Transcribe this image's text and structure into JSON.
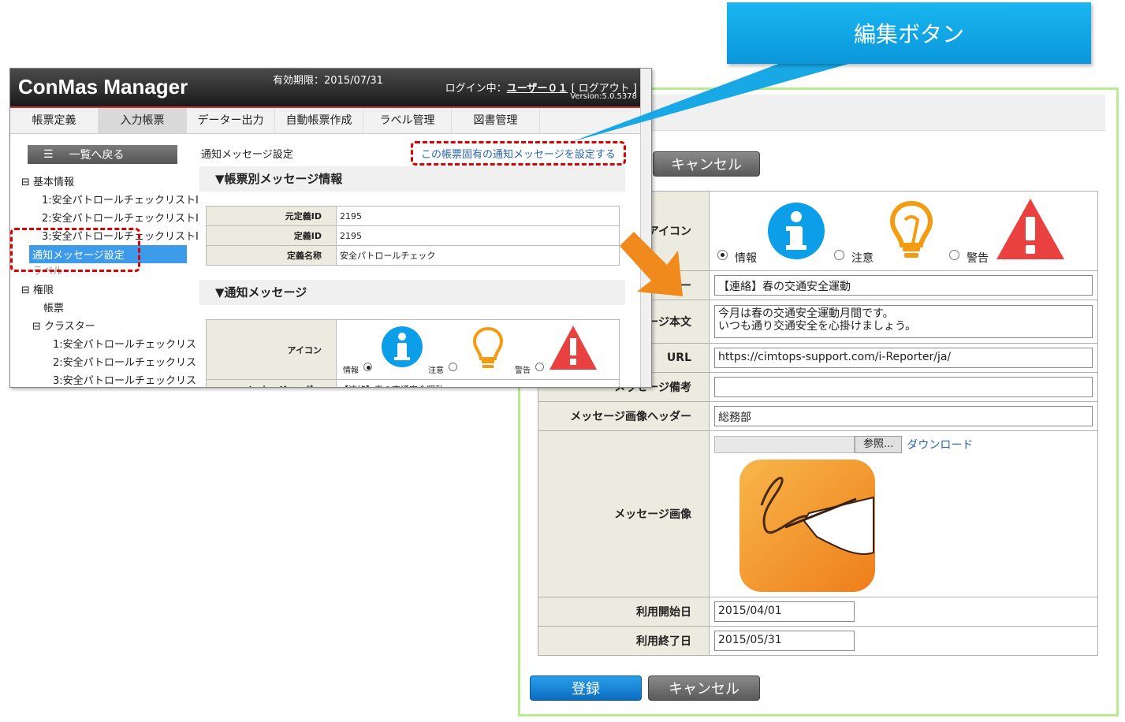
{
  "callout": {
    "label": "編集ボタン"
  },
  "app": {
    "title": "ConMas Manager",
    "expiry": "有効期限：2015/07/31",
    "login_prefix": "ログイン中：",
    "user": "ユーザー０１",
    "logout": "[ ログアウト ]",
    "version": "Version:5.0.5378",
    "tabs": [
      "帳票定義",
      "入力帳票",
      "データー出力",
      "自動帳票作成",
      "ラベル管理",
      "図書管理"
    ],
    "back_button": "一覧へ戻る",
    "tree": {
      "basic": "基本情報",
      "item1": "1:安全パトロールチェックリストI",
      "item2": "2:安全パトロールチェックリストI",
      "item3": "3:安全パトロールチェックリストI",
      "notify": "通知メッセージ設定",
      "label": "ラベル",
      "permission": "権限",
      "sheet": "帳票",
      "cluster": "クラスター",
      "c1": "1:安全パトロールチェックリス",
      "c2": "2:安全パトロールチェックリス",
      "c3": "3:安全パトロールチェックリス"
    },
    "breadcrumb": "通知メッセージ設定",
    "set_link": "この帳票固有の通知メッセージを設定する",
    "section1": "▼帳票別メッセージ情報",
    "info_rows": [
      {
        "label": "元定義ID",
        "value": "2195"
      },
      {
        "label": "定義ID",
        "value": "2195"
      },
      {
        "label": "定義名称",
        "value": "安全パトロールチェック"
      }
    ],
    "section2": "▼通知メッセージ",
    "icon_label": "アイコン",
    "radio_info": "情報",
    "radio_caution": "注意",
    "radio_warning": "警告",
    "header_label": "メッセージヘッダー",
    "header_value": "【連絡】春の交通安全運動"
  },
  "detail": {
    "cancel_top": "キャンセル",
    "icon_label": "アイコン",
    "radio_info": "情報",
    "radio_caution": "注意",
    "radio_warning": "警告",
    "header_label": "ー",
    "header_value": "【連絡】春の交通安全運動",
    "body_label": "ージ本文",
    "body_value": "今月は春の交通安全運動月間です。\nいつも通り交通安全を心掛けましょう。",
    "url_label": "URL",
    "url_value": "https://cimtops-support.com/i-Reporter/ja/",
    "note_label": "メッセージ備考",
    "note_value": "",
    "img_header_label": "メッセージ画像ヘッダー",
    "img_header_value": "総務部",
    "browse": "参照...",
    "download": "ダウンロード",
    "image_label": "メッセージ画像",
    "start_label": "利用開始日",
    "start_value": "2015/04/01",
    "end_label": "利用終了日",
    "end_value": "2015/05/31",
    "register": "登録",
    "cancel_bottom": "キャンセル"
  },
  "colors": {
    "accent_blue": "#0a97da",
    "highlight_red": "#dd0000",
    "panel_border": "#b8ec8e",
    "orange_arrow": "#f08a1c"
  }
}
